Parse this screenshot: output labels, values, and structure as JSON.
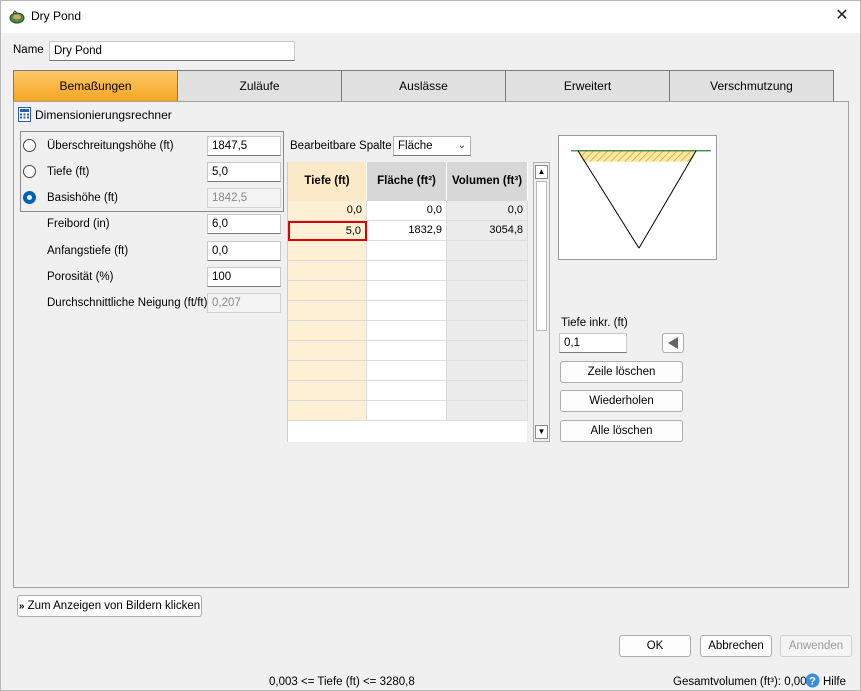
{
  "window": {
    "title": "Dry Pond",
    "close_icon": "close-icon"
  },
  "name_field": {
    "label": "Name",
    "value": "Dry Pond"
  },
  "tabs": [
    {
      "label": "Bemaßungen",
      "active": true
    },
    {
      "label": "Zuläufe"
    },
    {
      "label": "Auslässe"
    },
    {
      "label": "Erweitert"
    },
    {
      "label": "Verschmutzung"
    }
  ],
  "calculator": {
    "title": "Dimensionierungsrechner",
    "icon": "calculator-icon",
    "radios": [
      {
        "label": "Überschreitungshöhe (ft)",
        "value": "1847,5",
        "checked": false
      },
      {
        "label": "Tiefe (ft)",
        "value": "5,0",
        "checked": false
      },
      {
        "label": "Basishöhe (ft)",
        "value": "1842,5",
        "checked": true
      }
    ],
    "fields": [
      {
        "label": "Freibord (in)",
        "value": "6,0"
      },
      {
        "label": "Anfangstiefe (ft)",
        "value": "0,0"
      },
      {
        "label": "Porosität (%)",
        "value": "100"
      },
      {
        "label": "Durchschnittliche Neigung (ft/ft)",
        "value": "0,207"
      }
    ]
  },
  "editable_column": {
    "label": "Bearbeitbare Spalte",
    "selected": "Fläche"
  },
  "table": {
    "headers": [
      "Tiefe (ft)",
      "Fläche (ft²)",
      "Volumen (ft³)"
    ],
    "rows": [
      [
        "0,0",
        "0,0",
        "0,0"
      ],
      [
        "5,0",
        "1832,9",
        "3054,8"
      ]
    ]
  },
  "depth_increment": {
    "label": "Tiefe inkr. (ft)",
    "value": "0,1"
  },
  "buttons": {
    "delete_row": "Zeile löschen",
    "repeat": "Wiederholen",
    "delete_all": "Alle löschen",
    "show_images": "Zum Anzeigen von Bildern klicken",
    "ok": "OK",
    "cancel": "Abbrechen",
    "apply": "Anwenden"
  },
  "status_bar": {
    "range": "0,003 <= Tiefe (ft) <= 3280,8",
    "total_volume": "Gesamtvolumen (ft³): 0,000",
    "help": "Hilfe"
  },
  "colors": {
    "active_tab": "#f5a623",
    "selection_border": "#e00000",
    "depth_column": "#fdf0d5",
    "radio_accent": "#005fb8"
  }
}
